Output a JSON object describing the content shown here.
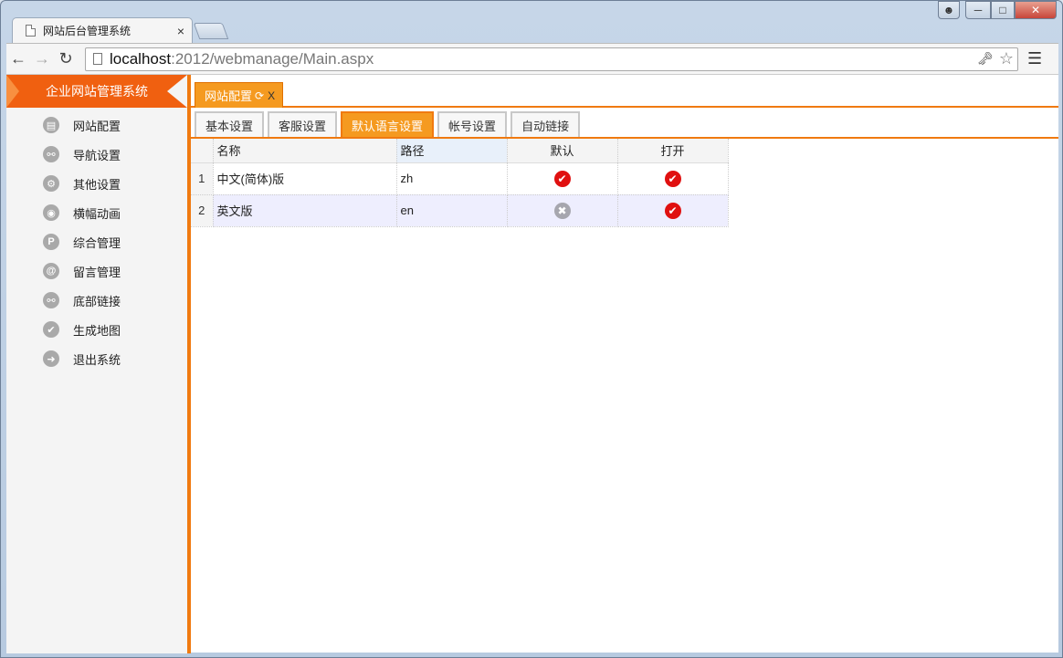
{
  "browser": {
    "tab_title": "网站后台管理系统",
    "tab_close": "×",
    "url_host": "localhost",
    "url_path": ":2012/webmanage/Main.aspx"
  },
  "sidebar": {
    "title": "企业网站管理系统",
    "items": [
      {
        "label": "网站配置",
        "icon": "list-icon",
        "glyph": "▤"
      },
      {
        "label": "导航设置",
        "icon": "link-icon",
        "glyph": "⚯"
      },
      {
        "label": "其他设置",
        "icon": "gear-icon",
        "glyph": "⚙"
      },
      {
        "label": "横幅动画",
        "icon": "camera-icon",
        "glyph": "◉"
      },
      {
        "label": "综合管理",
        "icon": "p-icon",
        "glyph": "P"
      },
      {
        "label": "留言管理",
        "icon": "at-icon",
        "glyph": "@"
      },
      {
        "label": "底部链接",
        "icon": "link-icon",
        "glyph": "⚯"
      },
      {
        "label": "生成地图",
        "icon": "check-icon",
        "glyph": "✔"
      },
      {
        "label": "退出系统",
        "icon": "arrow-right-icon",
        "glyph": "➜"
      }
    ]
  },
  "outer_tab": {
    "label": "网站配置",
    "close": "X"
  },
  "inner_tabs": [
    {
      "label": "基本设置",
      "active": false
    },
    {
      "label": "客服设置",
      "active": false
    },
    {
      "label": "默认语言设置",
      "active": true
    },
    {
      "label": "帐号设置",
      "active": false
    },
    {
      "label": "自动链接",
      "active": false
    }
  ],
  "grid": {
    "headers": {
      "name": "名称",
      "path": "路径",
      "default": "默认",
      "open": "打开"
    },
    "rows": [
      {
        "num": "1",
        "name": "中文(简体)版",
        "path": "zh",
        "default": true,
        "open": true
      },
      {
        "num": "2",
        "name": "英文版",
        "path": "en",
        "default": false,
        "open": true
      }
    ]
  },
  "colors": {
    "accent": "#f07a10",
    "check": "#e01010",
    "cross": "#a6a6ae"
  }
}
